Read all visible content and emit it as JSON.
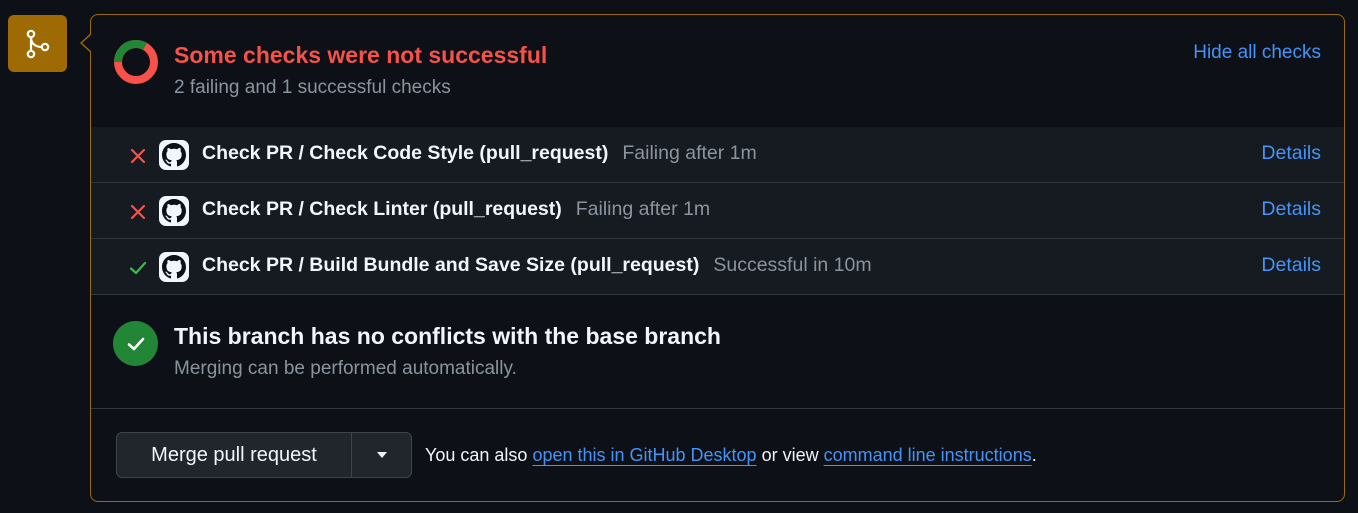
{
  "checks": {
    "title": "Some checks were not successful",
    "subtitle": "2 failing and 1 successful checks",
    "hide_link": "Hide all checks",
    "summary": {
      "failing": 2,
      "successful": 1
    },
    "rows": [
      {
        "name": "Check PR / Check Code Style (pull_request)",
        "status_text": "Failing after 1m",
        "status": "failing",
        "details": "Details"
      },
      {
        "name": "Check PR / Check Linter (pull_request)",
        "status_text": "Failing after 1m",
        "status": "failing",
        "details": "Details"
      },
      {
        "name": "Check PR / Build Bundle and Save Size (pull_request)",
        "status_text": "Successful in 10m",
        "status": "success",
        "details": "Details"
      }
    ]
  },
  "conflicts": {
    "title": "This branch has no conflicts with the base branch",
    "subtitle": "Merging can be performed automatically."
  },
  "merge": {
    "button_label": "Merge pull request",
    "note_prefix": "You can also",
    "desktop_link": "open this in GitHub Desktop",
    "note_middle": "or view",
    "cli_link": "command line instructions",
    "note_suffix": "."
  },
  "colors": {
    "failing": "#f85149",
    "success": "#238636",
    "link": "#4493f8",
    "merge_accent": "#9e6a03"
  },
  "icons": {
    "merge": "git-merge-icon",
    "failing": "x-icon",
    "success": "check-icon",
    "app": "github-icon",
    "dropdown": "triangle-down-icon"
  }
}
